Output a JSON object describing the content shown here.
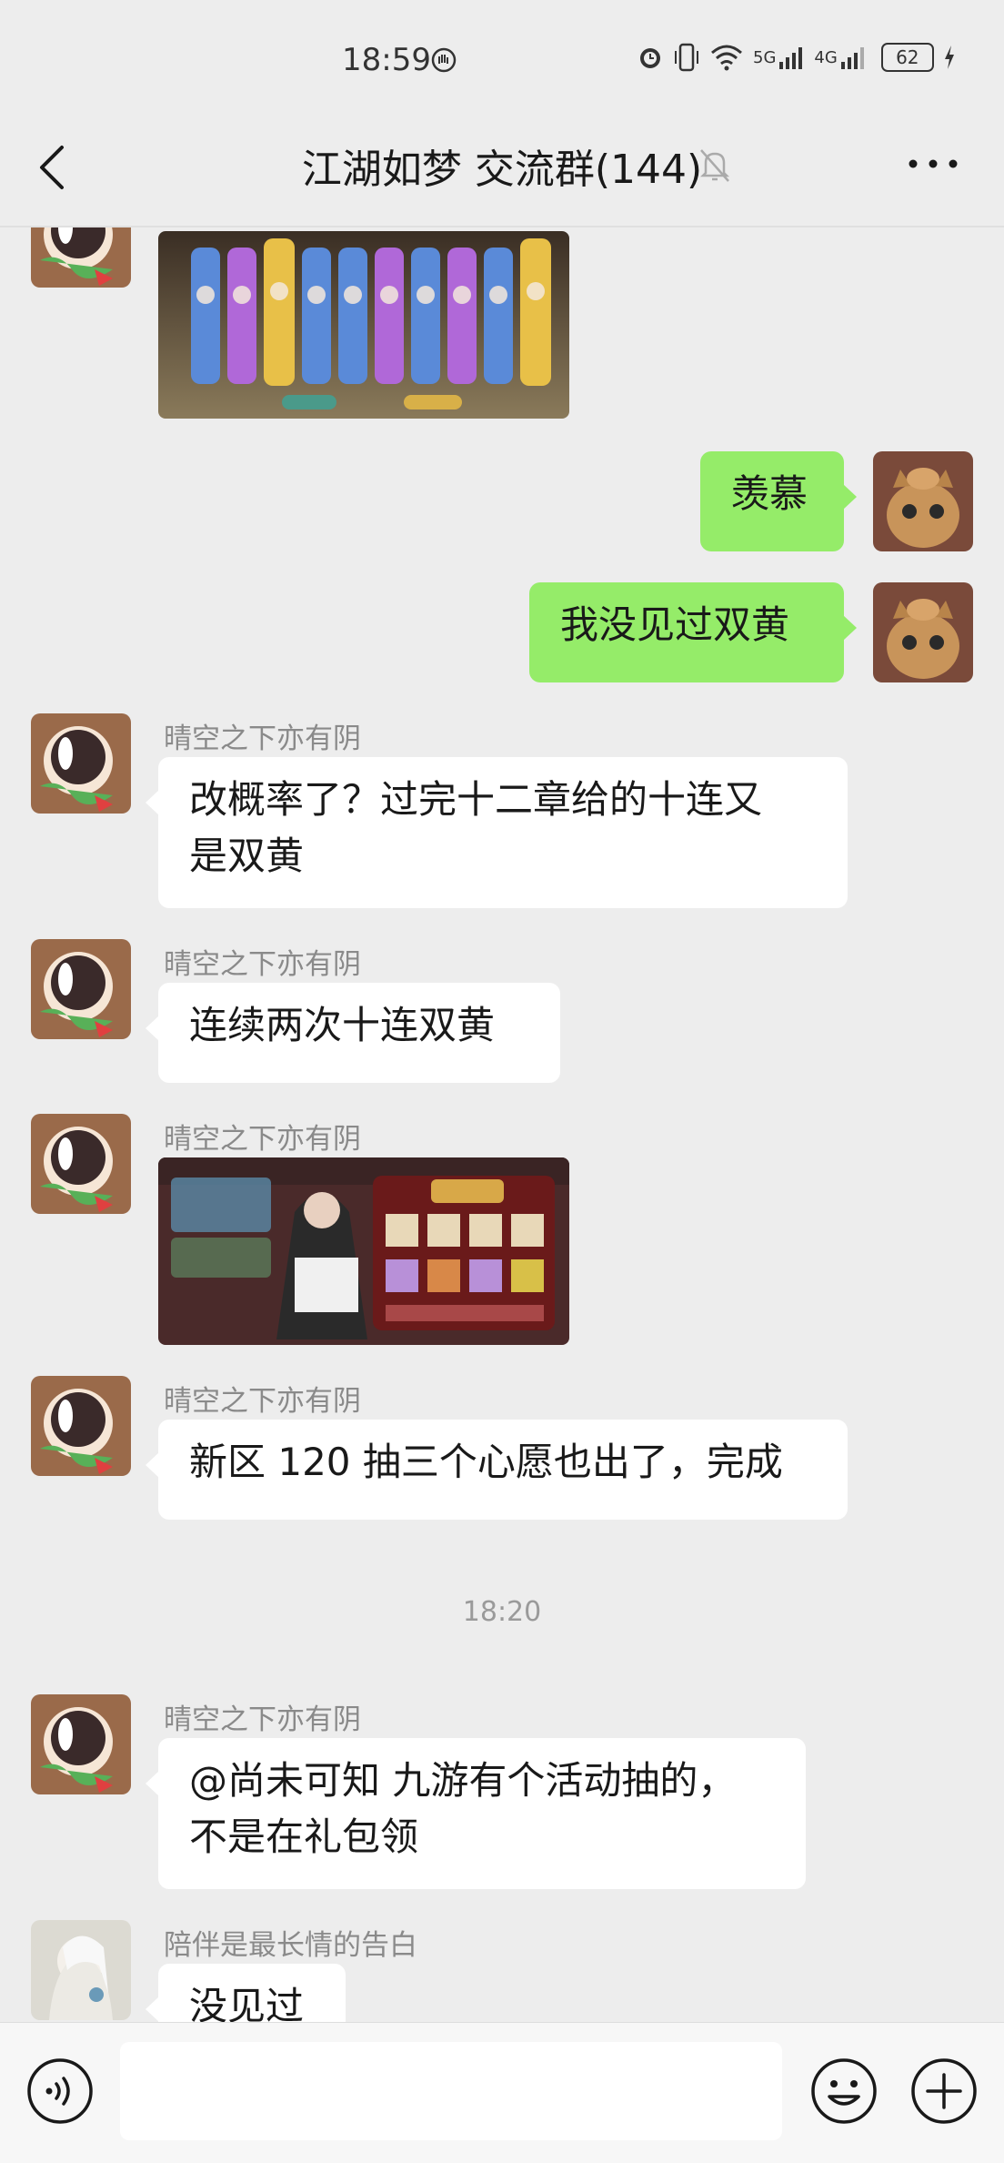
{
  "status_bar": {
    "time": "18:59",
    "signal1": "5G",
    "signal2": "4G",
    "battery": "62"
  },
  "nav": {
    "title": "江湖如梦 交流群(144)"
  },
  "messages": [
    {
      "type": "image",
      "side": "left",
      "desc": "game-gacha-cards-image"
    },
    {
      "type": "text",
      "side": "right",
      "text": "羡慕"
    },
    {
      "type": "text",
      "side": "right",
      "text": "我没见过双黄"
    },
    {
      "type": "text",
      "side": "left",
      "sender": "晴空之下亦有阴",
      "line1": "改概率了？过完十二章给的十连又",
      "line2": "是双黄"
    },
    {
      "type": "text",
      "side": "left",
      "sender": "晴空之下亦有阴",
      "text": "连续两次十连双黄"
    },
    {
      "type": "image",
      "side": "left",
      "sender": "晴空之下亦有阴",
      "desc": "game-reward-preview-image"
    },
    {
      "type": "text",
      "side": "left",
      "sender": "晴空之下亦有阴",
      "text": "新区 120 抽三个心愿也出了，完成"
    },
    {
      "type": "timestamp",
      "text": "18:20"
    },
    {
      "type": "text",
      "side": "left",
      "sender": "晴空之下亦有阴",
      "line1": "@尚未可知  九游有个活动抽的，",
      "line2": "不是在礼包领"
    },
    {
      "type": "text",
      "side": "left",
      "sender": "陪伴是最长情的告白",
      "text": "没见过"
    }
  ],
  "icons": {
    "back": "back-arrow-icon",
    "mute": "bell-off-icon",
    "more": "more-dots-icon",
    "voice": "voice-icon",
    "emoji": "emoji-icon",
    "plus": "plus-icon"
  },
  "colors": {
    "background": "#ededed",
    "bubble_self": "#95ec69",
    "bubble_other": "#ffffff"
  }
}
